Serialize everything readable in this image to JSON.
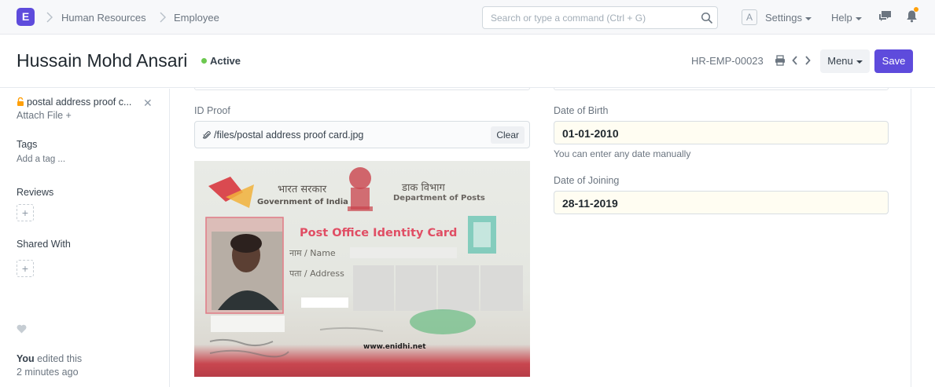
{
  "navbar": {
    "logo": "E",
    "breadcrumbs": [
      "Human Resources",
      "Employee"
    ],
    "search_placeholder": "Search or type a command (Ctrl + G)",
    "avatar_letter": "A",
    "settings": "Settings",
    "help": "Help"
  },
  "page": {
    "title": "Hussain Mohd Ansari",
    "status": "Active",
    "doc_name": "HR-EMP-00023",
    "menu": "Menu",
    "save": "Save"
  },
  "sidebar": {
    "attachment": "postal address proof c...",
    "attach_file": "Attach File",
    "tags_heading": "Tags",
    "add_tag": "Add a tag ...",
    "reviews_heading": "Reviews",
    "shared_heading": "Shared With",
    "edited_by": "You",
    "edited_text": "edited this",
    "edited_time": "2 minutes ago"
  },
  "form": {
    "id_proof_label": "ID Proof",
    "id_proof_value": "/files/postal address proof card.jpg",
    "clear": "Clear",
    "dob_label": "Date of Birth",
    "dob_value": "01-01-2010",
    "dob_help": "You can enter any date manually",
    "doj_label": "Date of Joining",
    "doj_value": "28-11-2019"
  },
  "card_image": {
    "hindi_gov": "भारत सरकार",
    "gov": "Government of India",
    "hindi_dept": "डाक विभाग",
    "dept": "Department of Posts",
    "title": "Post Office Identity Card",
    "name_label": "नाम / Name",
    "address_label": "पता / Address",
    "website": "www.enidhi.net"
  },
  "colors": {
    "accent": "#5e4bdc",
    "active": "#6cc84f",
    "notification": "#ffa00a"
  }
}
